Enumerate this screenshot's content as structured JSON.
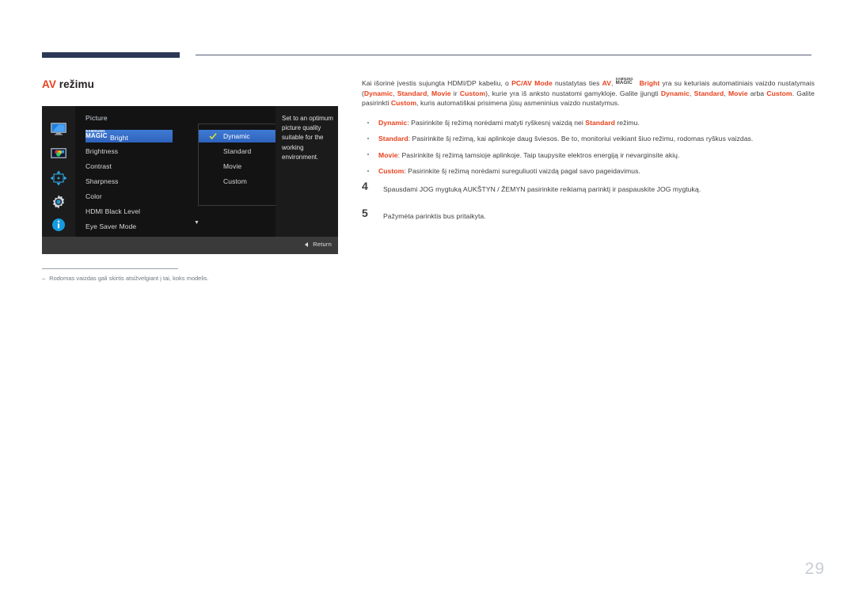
{
  "header": {
    "accent_bar_color": "#2b3755",
    "rule_color": "#575e78"
  },
  "section": {
    "title_accent": "AV",
    "title_rest": " režimu"
  },
  "osd": {
    "panel_title": "Picture",
    "icons": [
      {
        "name": "display-icon"
      },
      {
        "name": "picture-icon"
      },
      {
        "name": "onscreen-display-icon"
      },
      {
        "name": "system-gear-icon"
      },
      {
        "name": "information-icon"
      }
    ],
    "menu_items": [
      {
        "label_prefix_top": "SAMSUNG",
        "label_prefix_bottom": "MAGIC",
        "label": "Bright",
        "selected": true
      },
      {
        "label": "Brightness",
        "selected": false
      },
      {
        "label": "Contrast",
        "selected": false
      },
      {
        "label": "Sharpness",
        "selected": false
      },
      {
        "label": "Color",
        "selected": false
      },
      {
        "label": "HDMI Black Level",
        "selected": false
      },
      {
        "label": "Eye Saver Mode",
        "selected": false
      }
    ],
    "scroll_down_indicator": "▼",
    "submenu_items": [
      {
        "label": "Dynamic",
        "checked": true,
        "selected": true
      },
      {
        "label": "Standard",
        "checked": false,
        "selected": false
      },
      {
        "label": "Movie",
        "checked": false,
        "selected": false
      },
      {
        "label": "Custom",
        "checked": false,
        "selected": false
      }
    ],
    "description": "Set to an optimum picture quality suitable for the working environment.",
    "return_label": "Return",
    "highlight_color": "#3e7ad4",
    "check_color": "#d8e43a"
  },
  "note": {
    "dash": "‒",
    "text": "Rodomas vaizdas gali skirtis atsižvelgiant į tai, koks modelis."
  },
  "body": {
    "paragraph": {
      "p1": "Kai išorinė įvestis sujungta HDMI/DP kabeliu, o ",
      "pcav": "PC/AV Mode",
      "p2": " nustatytas ties ",
      "av": "AV",
      "p3": ", ",
      "magic_top": "SAMSUNG",
      "magic_bottom": "MAGIC",
      "bright": "Bright",
      "p4": " yra su keturiais automatiniais vaizdo nustatymais (",
      "m1": "Dynamic",
      "c1": ", ",
      "m2": "Standard",
      "c2": ", ",
      "m3": "Movie",
      "c3": " ir ",
      "m4": "Custom",
      "p5": "), kurie yra iš anksto nustatomi gamykloje. Galite įjungti ",
      "m5": "Dynamic",
      "c4": ", ",
      "m6": "Standard",
      "c5": ", ",
      "m7": "Movie",
      "c6": " arba ",
      "m8": "Custom",
      "p6": ". Galite pasirinkti ",
      "m9": "Custom",
      "p7": ", kuris automatiškai prisimena jūsų asmeninius vaizdo nustatymus."
    },
    "bullets": [
      {
        "term": "Dynamic",
        "text_before": ": Pasirinkite šį režimą norėdami matyti ryškesnį vaizdą nei ",
        "term2": "Standard",
        "text_after": " režimu."
      },
      {
        "term": "Standard",
        "text_before": ": Pasirinkite šį režimą, kai aplinkoje daug šviesos. Be to, monitoriui veikiant šiuo režimu, rodomas ryškus vaizdas.",
        "term2": "",
        "text_after": ""
      },
      {
        "term": "Movie",
        "text_before": ": Pasirinkite šį režimą tamsioje aplinkoje. Taip taupysite elektros energiją ir nevarginsite akių.",
        "term2": "",
        "text_after": ""
      },
      {
        "term": "Custom",
        "text_before": ": Pasirinkite šį režimą norėdami sureguliuoti vaizdą pagal savo pageidavimus.",
        "term2": "",
        "text_after": ""
      }
    ],
    "steps": [
      {
        "num": "4",
        "text": "Spausdami JOG mygtuką AUKŠTYN / ŽEMYN pasirinkite reikiamą parinktį ir paspauskite JOG mygtuką."
      },
      {
        "num": "5",
        "text": "Pažymėta parinktis bus pritaikyta."
      }
    ]
  },
  "page_number": "29"
}
